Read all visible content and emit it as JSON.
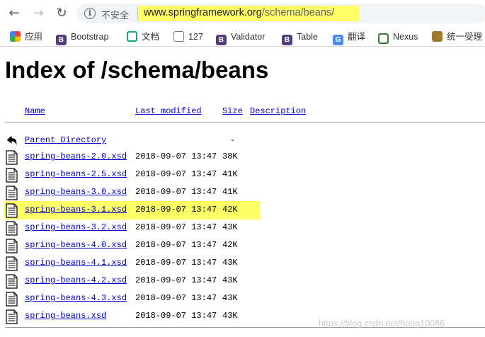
{
  "browser": {
    "security_label": "不安全",
    "url_host": "www.springframework.org",
    "url_path": "/schema/beans/",
    "bookmarks": [
      {
        "label": "应用",
        "icon": "apps-grid-icon"
      },
      {
        "label": "Bootstrap",
        "icon": "bootstrap-icon"
      },
      {
        "label": "文档",
        "icon": "doc-icon"
      },
      {
        "label": "127",
        "icon": "page-icon"
      },
      {
        "label": "Validator",
        "icon": "bootstrap-icon"
      },
      {
        "label": "Table",
        "icon": "bootstrap-icon"
      },
      {
        "label": "翻译",
        "icon": "translate-icon"
      },
      {
        "label": "Nexus",
        "icon": "nexus-icon"
      },
      {
        "label": "统一受理",
        "icon": "folder-icon"
      }
    ]
  },
  "page": {
    "title": "Index of /schema/beans",
    "columns": {
      "name": "Name",
      "modified": "Last modified",
      "size": "Size",
      "description": "Description"
    },
    "parent": {
      "label": "Parent Directory",
      "size": "-"
    },
    "files": [
      {
        "name": "spring-beans-2.0.xsd",
        "modified": "2018-09-07 13:47",
        "size": "38K",
        "highlighted": false
      },
      {
        "name": "spring-beans-2.5.xsd",
        "modified": "2018-09-07 13:47",
        "size": "41K",
        "highlighted": false
      },
      {
        "name": "spring-beans-3.0.xsd",
        "modified": "2018-09-07 13:47",
        "size": "41K",
        "highlighted": false
      },
      {
        "name": "spring-beans-3.1.xsd",
        "modified": "2018-09-07 13:47",
        "size": "42K",
        "highlighted": true
      },
      {
        "name": "spring-beans-3.2.xsd",
        "modified": "2018-09-07 13:47",
        "size": "43K",
        "highlighted": false
      },
      {
        "name": "spring-beans-4.0.xsd",
        "modified": "2018-09-07 13:47",
        "size": "42K",
        "highlighted": false
      },
      {
        "name": "spring-beans-4.1.xsd",
        "modified": "2018-09-07 13:47",
        "size": "43K",
        "highlighted": false
      },
      {
        "name": "spring-beans-4.2.xsd",
        "modified": "2018-09-07 13:47",
        "size": "43K",
        "highlighted": false
      },
      {
        "name": "spring-beans-4.3.xsd",
        "modified": "2018-09-07 13:47",
        "size": "43K",
        "highlighted": false
      },
      {
        "name": "spring-beans.xsd",
        "modified": "2018-09-07 13:47",
        "size": "43K",
        "highlighted": false
      }
    ]
  },
  "watermark": "https://blog.csdn.net/hong10086"
}
